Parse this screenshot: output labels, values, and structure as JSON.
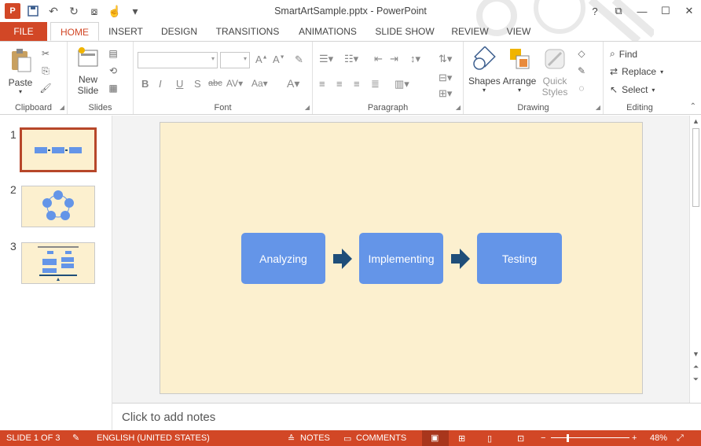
{
  "window": {
    "title": "SmartArtSample.pptx - PowerPoint",
    "app_icon": "P",
    "controls": [
      "?",
      "⧉",
      "—",
      "☐",
      "✕"
    ]
  },
  "tabs": [
    "FILE",
    "HOME",
    "INSERT",
    "DESIGN",
    "TRANSITIONS",
    "ANIMATIONS",
    "SLIDE SHOW",
    "REVIEW",
    "VIEW"
  ],
  "active_tab": "HOME",
  "ribbon": {
    "clipboard": {
      "label": "Clipboard",
      "paste": "Paste"
    },
    "slides": {
      "label": "Slides",
      "new_slide_line1": "New",
      "new_slide_line2": "Slide"
    },
    "font": {
      "label": "Font",
      "font_name": "",
      "font_size": ""
    },
    "paragraph": {
      "label": "Paragraph"
    },
    "drawing": {
      "label": "Drawing",
      "shapes": "Shapes",
      "arrange": "Arrange",
      "quick_styles_line1": "Quick",
      "quick_styles_line2": "Styles"
    },
    "editing": {
      "label": "Editing",
      "find": "Find",
      "replace": "Replace",
      "select": "Select"
    }
  },
  "thumbnails": [
    "1",
    "2",
    "3"
  ],
  "slide": {
    "boxes": [
      "Analyzing",
      "Implementing",
      "Testing"
    ],
    "box_color": "#6495e8",
    "arrow_color": "#1f4e79",
    "background": "#fcf0cf"
  },
  "notes_placeholder": "Click to add notes",
  "status": {
    "slide_info": "SLIDE 1 OF 3",
    "language": "ENGLISH (UNITED STATES)",
    "notes": "NOTES",
    "comments": "COMMENTS",
    "zoom": "48%"
  },
  "colors": {
    "accent": "#d24726"
  }
}
